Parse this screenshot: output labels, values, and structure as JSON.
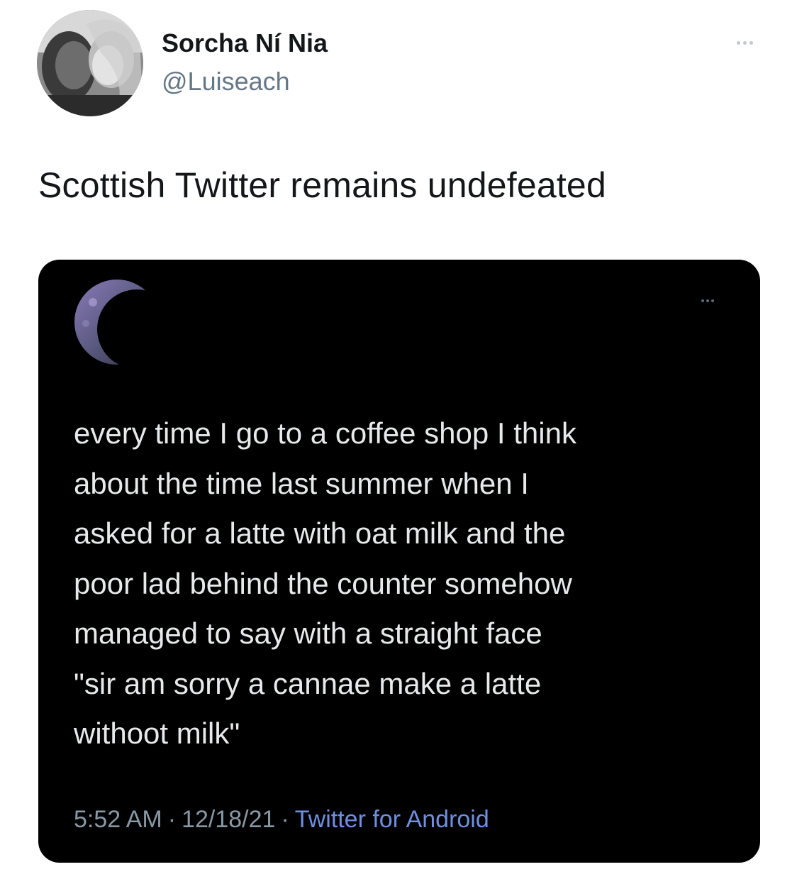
{
  "author": {
    "display_name": "Sorcha Ní Nia",
    "handle": "@Luiseach",
    "avatar_icon": "profile-photo"
  },
  "tweet": {
    "text": "Scottish Twitter remains undefeated",
    "more_icon": "more-options-icon"
  },
  "quoted_tweet": {
    "avatar_icon": "crescent-moon-avatar",
    "body": "every time I go to a coffee shop I think\nabout the time last summer when I\nasked for a latte with oat milk and the\npoor lad behind the counter somehow\nmanaged to say with a straight face\n\"sir am sorry a cannae make a latte\nwithoot milk\"",
    "time": "5:52 AM",
    "separator": "·",
    "date": "12/18/21",
    "source": "Twitter for Android",
    "colors": {
      "background": "#000000",
      "text": "#e7e9ea",
      "meta": "#8899a6",
      "source_link": "#6f8fe0"
    }
  }
}
